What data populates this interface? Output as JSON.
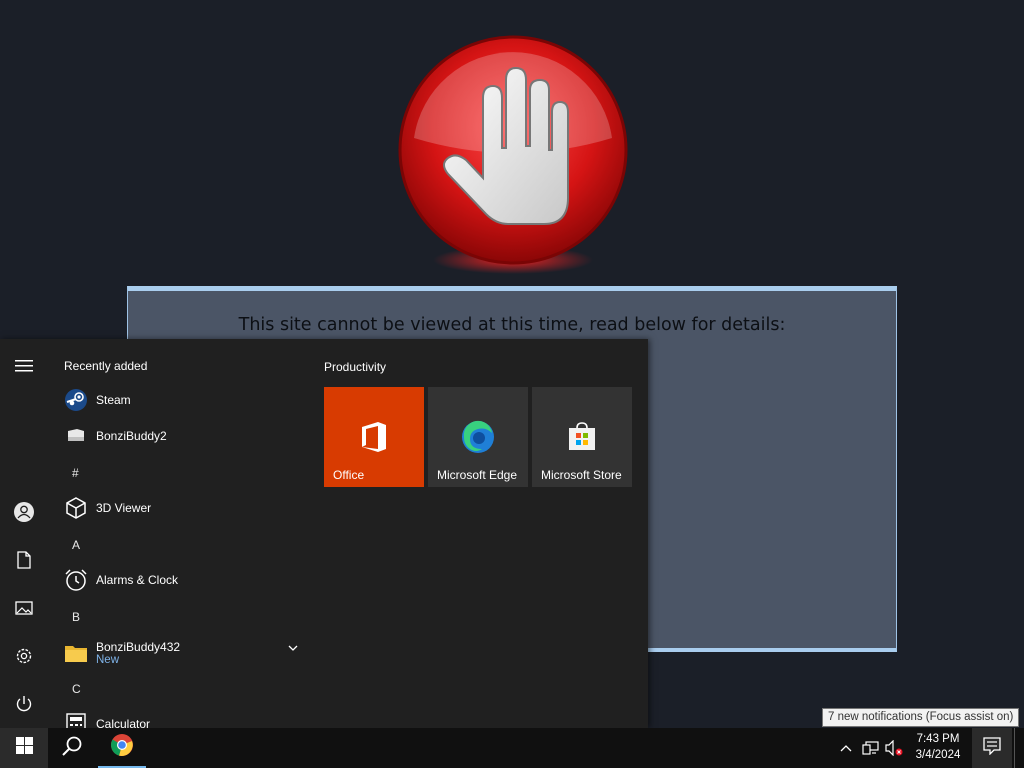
{
  "blocked_page": {
    "heading": "This site cannot be viewed at this time, read below for details:",
    "logo": "stop-hand-icon",
    "accent_color": "#cc1414"
  },
  "start_menu": {
    "rail": [
      "menu-icon",
      "user-icon",
      "documents-icon",
      "pictures-icon",
      "settings-icon",
      "power-icon"
    ],
    "recently_added_label": "Recently added",
    "apps": [
      {
        "label": "Steam",
        "icon": "steam-icon"
      },
      {
        "label": "BonziBuddy2",
        "icon": "file-icon"
      },
      {
        "label": "3D Viewer",
        "icon": "cube-icon"
      },
      {
        "label": "Alarms & Clock",
        "icon": "alarm-clock-icon"
      },
      {
        "label": "BonziBuddy432",
        "sublabel": "New",
        "icon": "folder-icon"
      },
      {
        "label": "Calculator",
        "icon": "calculator-icon"
      }
    ],
    "letters": [
      "#",
      "A",
      "B",
      "C"
    ],
    "group_label": "Productivity",
    "tiles": [
      {
        "label": "Office",
        "color": "#d83b01",
        "icon": "office-icon"
      },
      {
        "label": "Microsoft Edge",
        "color": "#333333",
        "icon": "edge-icon"
      },
      {
        "label": "Microsoft Store",
        "color": "#333333",
        "icon": "store-icon"
      }
    ]
  },
  "taskbar": {
    "time": "7:43 PM",
    "date": "3/4/2024",
    "tooltip": "7 new notifications (Focus assist on)",
    "pinned": [
      "start-icon",
      "search-icon",
      "chrome-icon"
    ],
    "tray": [
      "chevron-up-icon",
      "network-icon",
      "volume-muted-icon",
      "notification-icon"
    ]
  }
}
